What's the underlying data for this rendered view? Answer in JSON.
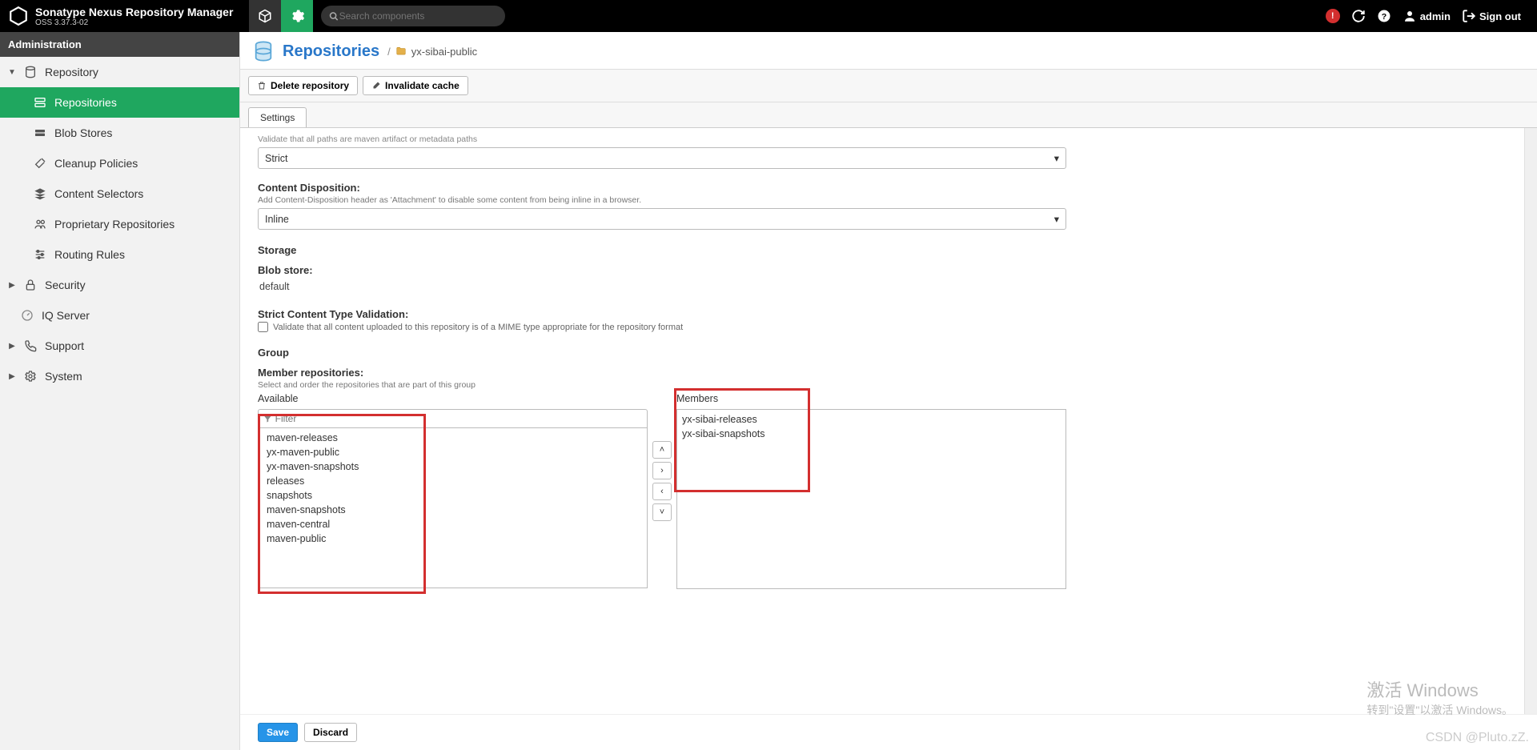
{
  "header": {
    "product": "Sonatype Nexus Repository Manager",
    "version": "OSS 3.37.3-02",
    "search_placeholder": "Search components",
    "user": "admin",
    "signout": "Sign out"
  },
  "sidebar": {
    "section": "Administration",
    "items": {
      "repository": "Repository",
      "repositories": "Repositories",
      "blobstores": "Blob Stores",
      "cleanup": "Cleanup Policies",
      "contentselectors": "Content Selectors",
      "proprietary": "Proprietary Repositories",
      "routing": "Routing Rules",
      "security": "Security",
      "iq": "IQ Server",
      "support": "Support",
      "system": "System"
    }
  },
  "page": {
    "title": "Repositories",
    "breadcrumb": "yx-sibai-public",
    "toolbar": {
      "delete": "Delete repository",
      "invalidate": "Invalidate cache"
    },
    "tab": "Settings"
  },
  "form": {
    "cutoff": "Validate that all paths are maven artifact or metadata paths",
    "strict_value": "Strict",
    "cd_label": "Content Disposition:",
    "cd_hint": "Add Content-Disposition header as 'Attachment' to disable some content from being inline in a browser.",
    "cd_value": "Inline",
    "storage_section": "Storage",
    "blob_label": "Blob store:",
    "blob_value": "default",
    "strictctv_label": "Strict Content Type Validation:",
    "strictctv_chk": "Validate that all content uploaded to this repository is of a MIME type appropriate for the repository format",
    "group_section": "Group",
    "members_label": "Member repositories:",
    "members_hint": "Select and order the repositories that are part of this group",
    "available_title": "Available",
    "members_title": "Members",
    "filter_placeholder": "Filter",
    "available": [
      "maven-releases",
      "yx-maven-public",
      "yx-maven-snapshots",
      "releases",
      "snapshots",
      "maven-snapshots",
      "maven-central",
      "maven-public"
    ],
    "members": [
      "yx-sibai-releases",
      "yx-sibai-snapshots"
    ]
  },
  "actions": {
    "save": "Save",
    "discard": "Discard"
  },
  "watermark": {
    "big": "激活 Windows",
    "small": "转到\"设置\"以激活 Windows。"
  },
  "csdn": "CSDN @Pluto.zZ."
}
